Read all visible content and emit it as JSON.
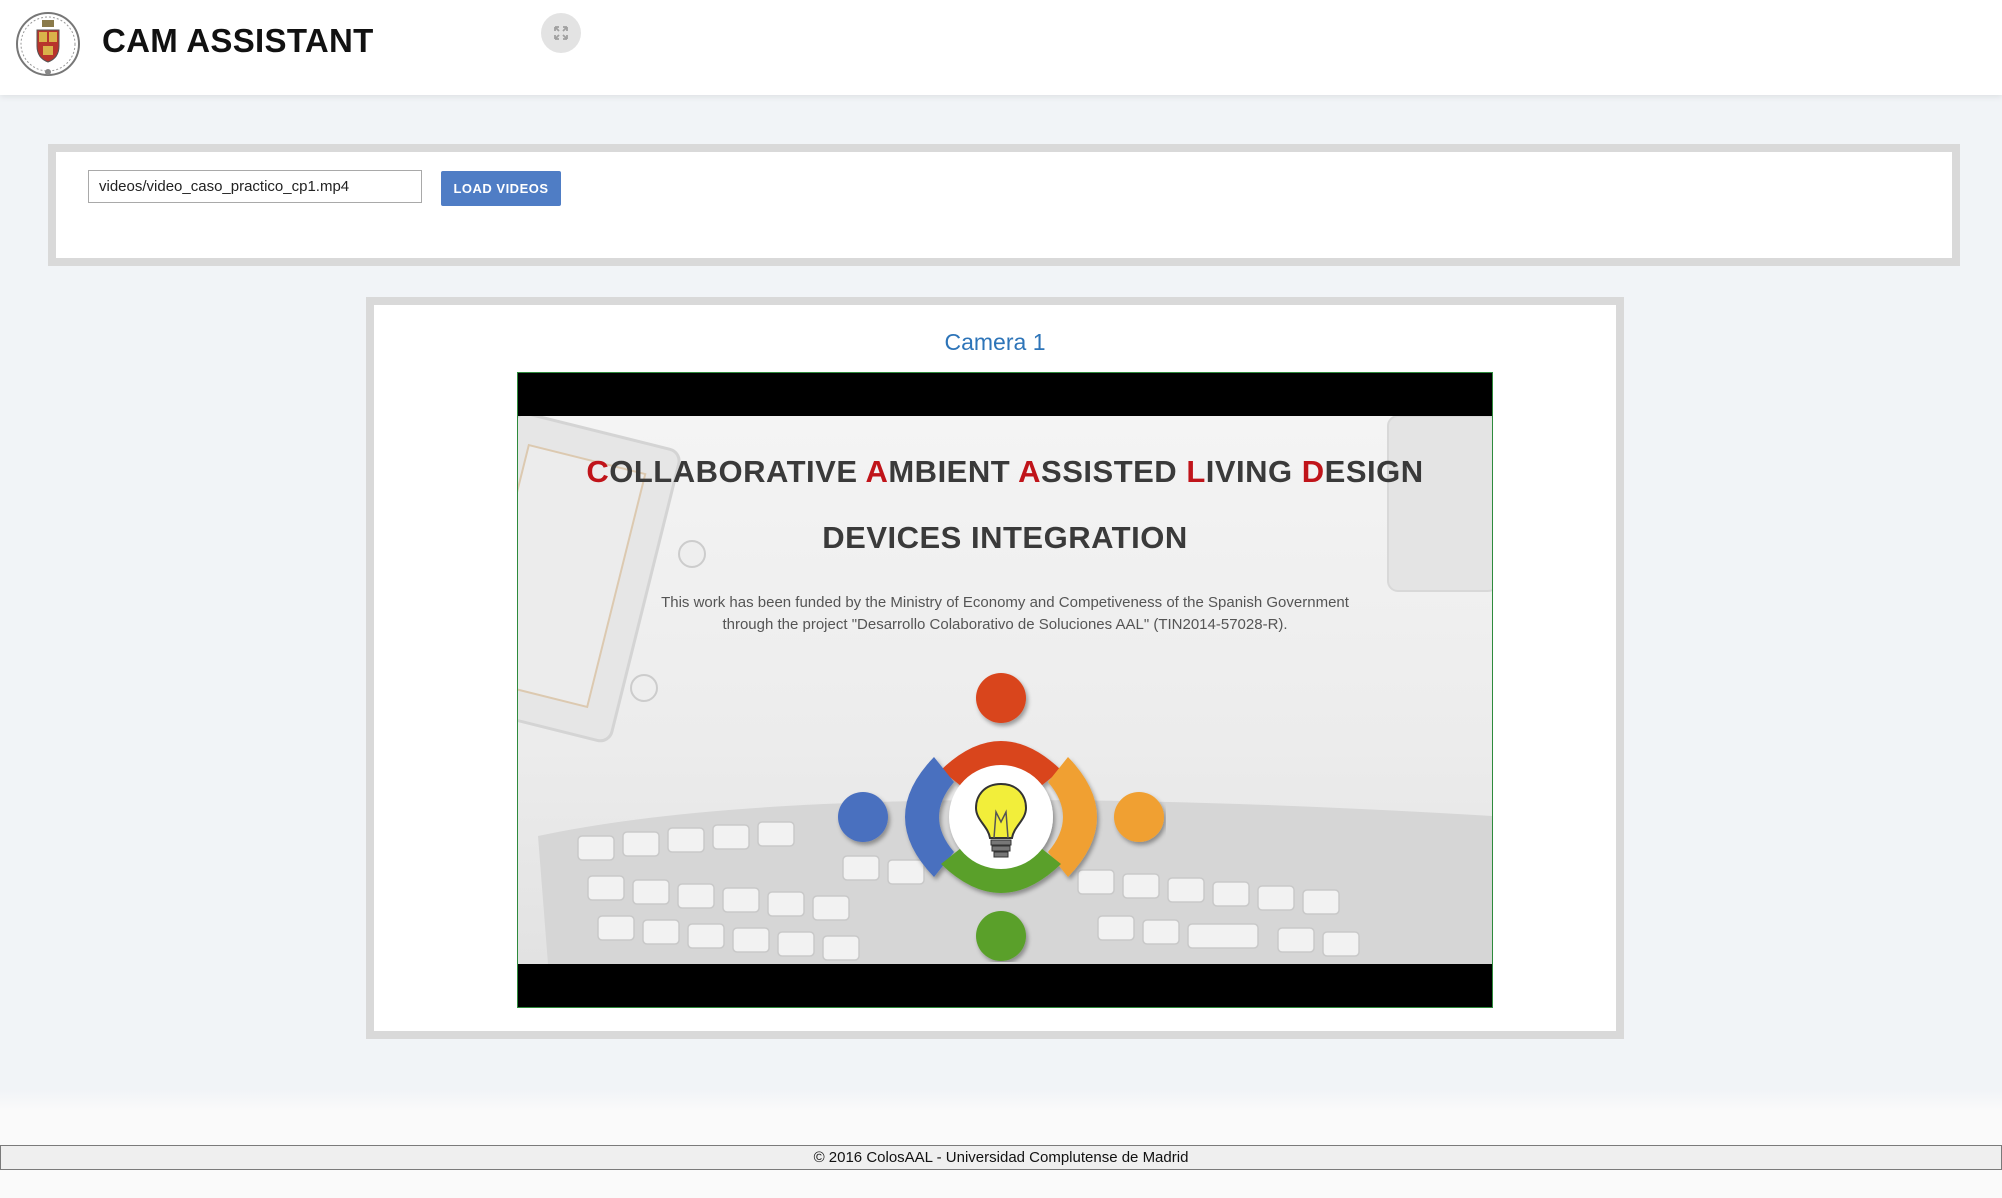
{
  "header": {
    "app_title": "CAM ASSISTANT",
    "fullscreen_icon": "expand-arrows-icon"
  },
  "loader": {
    "video_path": "videos/video_caso_practico_cp1.mp4",
    "load_button_label": "LOAD VIDEOS"
  },
  "camera": {
    "title": "Camera 1",
    "frame": {
      "title_parts": [
        {
          "initial": "C",
          "rest": "OLLABORATIVE "
        },
        {
          "initial": "A",
          "rest": "MBIENT "
        },
        {
          "initial": "A",
          "rest": "SSISTED "
        },
        {
          "initial": "L",
          "rest": "IVING "
        },
        {
          "initial": "D",
          "rest": "ESIGN"
        }
      ],
      "subtitle": "DEVICES INTEGRATION",
      "funding_line1": "This work has been funded by the Ministry of Economy and Competiveness of the Spanish Government",
      "funding_line2": "through the project \"Desarrollo Colaborativo de Soluciones AAL\" (TIN2014-57028-R).",
      "logo_colors": {
        "red": "#d9441c",
        "blue": "#4a6fbf",
        "orange": "#f0a030",
        "green": "#5aa02c",
        "bulb": "#f2ee3a"
      }
    }
  },
  "footer": {
    "text": "© 2016 ColosAAL - Universidad Complutense de Madrid"
  },
  "colors": {
    "accent_blue": "#4f7dc5",
    "camera_title": "#2d74b8",
    "title_red": "#c0141a"
  }
}
